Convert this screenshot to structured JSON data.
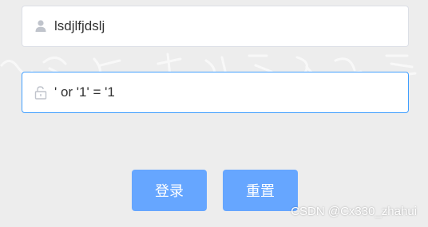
{
  "login_form": {
    "username": {
      "value": "lsdjlfjdslj",
      "icon": "user-icon"
    },
    "password": {
      "value": "' or '1' = '1",
      "icon": "unlocked-lock-icon"
    },
    "login_button_label": "登录",
    "reset_button_label": "重置"
  },
  "watermark": "CSDN @Cx330_zhahui",
  "colors": {
    "page_background": "#ededed",
    "button_background": "#66a6ff",
    "focus_border": "#409eff",
    "icon": "#c0c4cc"
  }
}
